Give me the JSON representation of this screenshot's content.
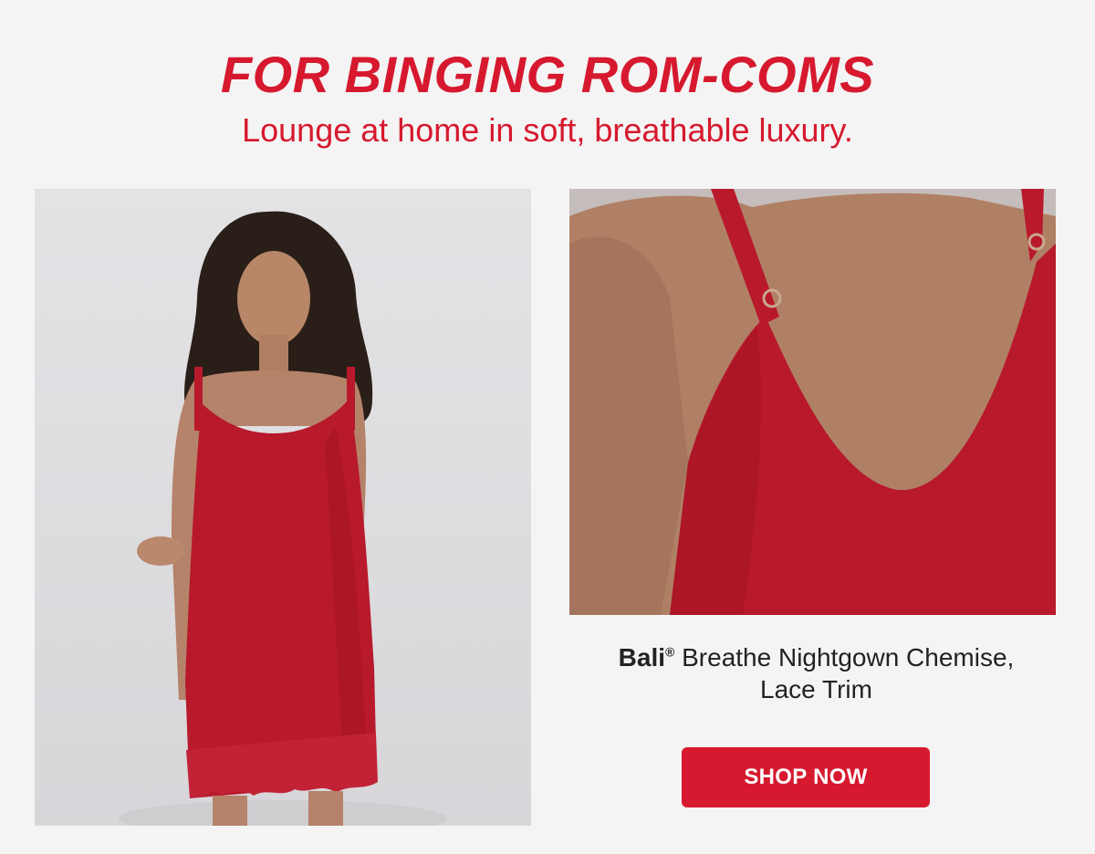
{
  "hero": {
    "headline": "FOR BINGING ROM-COMS",
    "subheadline": "Lounge at home in soft, breathable luxury."
  },
  "product": {
    "brand": "Bali",
    "registered_mark": "®",
    "name_line_1": " Breathe Nightgown Chemise,",
    "name_line_2": "Lace Trim"
  },
  "cta": {
    "label": "SHOP NOW"
  },
  "colors": {
    "accent": "#d6192e",
    "background": "#f4f4f4",
    "text": "#222222",
    "garment": "#b8192b"
  }
}
